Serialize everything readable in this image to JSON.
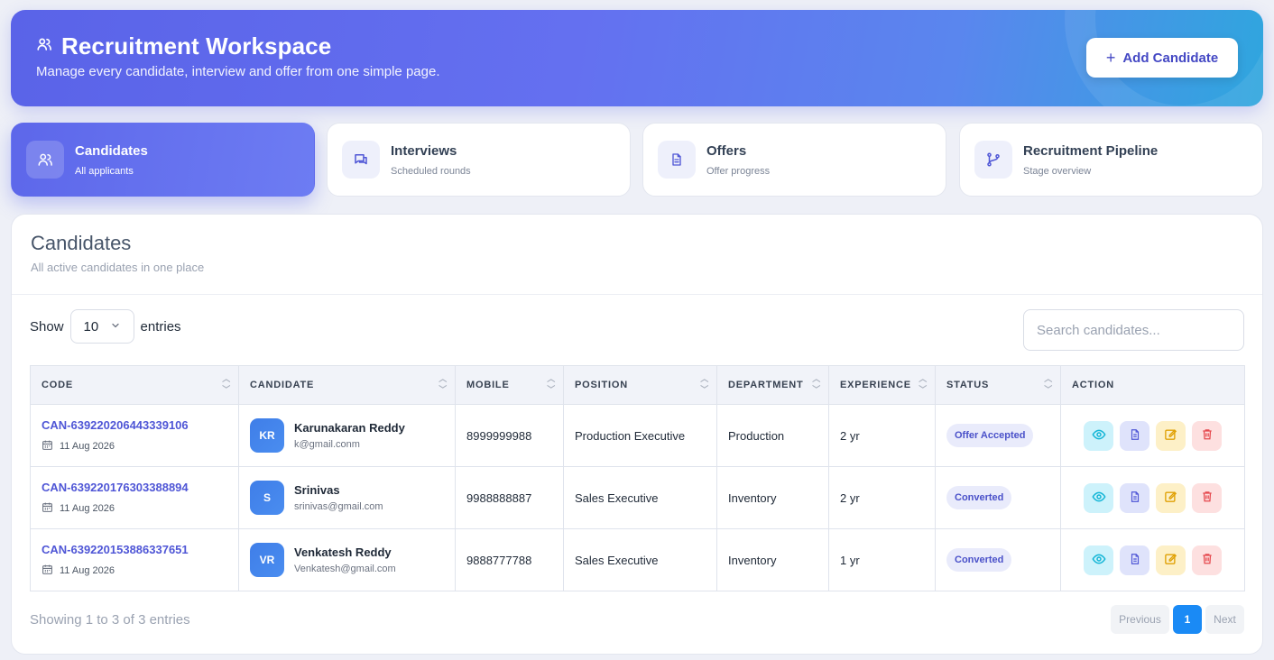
{
  "header": {
    "title": "Recruitment Workspace",
    "subtitle": "Manage every candidate, interview and offer from one simple page.",
    "add_button_label": "Add Candidate",
    "title_icon": "users-icon",
    "add_icon": "plus-icon"
  },
  "tabs": [
    {
      "label": "Candidates",
      "sub": "All applicants",
      "icon": "users-icon",
      "active": true
    },
    {
      "label": "Interviews",
      "sub": "Scheduled rounds",
      "icon": "chat-icon",
      "active": false
    },
    {
      "label": "Offers",
      "sub": "Offer progress",
      "icon": "document-icon",
      "active": false
    },
    {
      "label": "Recruitment Pipeline",
      "sub": "Stage overview",
      "icon": "branch-icon",
      "active": false
    }
  ],
  "card": {
    "title": "Candidates",
    "subtitle": "All active candidates in one place"
  },
  "controls": {
    "show_label": "Show",
    "entries_value": "10",
    "entries_label": "entries",
    "search_placeholder": "Search candidates..."
  },
  "table": {
    "columns": [
      "CODE",
      "CANDIDATE",
      "MOBILE",
      "POSITION",
      "DEPARTMENT",
      "EXPERIENCE",
      "STATUS",
      "ACTION"
    ],
    "rows": [
      {
        "code": "CAN-639220206443339106",
        "date": "11 Aug 2026",
        "initials": "KR",
        "name": "Karunakaran Reddy",
        "email": "k@gmail.conm",
        "mobile": "8999999988",
        "position": "Production Executive",
        "department": "Production",
        "experience": "2 yr",
        "status": "Offer Accepted"
      },
      {
        "code": "CAN-639220176303388894",
        "date": "11 Aug 2026",
        "initials": "S",
        "name": "Srinivas",
        "email": "srinivas@gmail.com",
        "mobile": "9988888887",
        "position": "Sales Executive",
        "department": "Inventory",
        "experience": "2 yr",
        "status": "Converted"
      },
      {
        "code": "CAN-639220153886337651",
        "date": "11 Aug 2026",
        "initials": "VR",
        "name": "Venkatesh Reddy",
        "email": "Venkatesh@gmail.com",
        "mobile": "9888777788",
        "position": "Sales Executive",
        "department": "Inventory",
        "experience": "1 yr",
        "status": "Converted"
      }
    ]
  },
  "footer": {
    "showing": "Showing 1 to 3 of 3 entries",
    "previous": "Previous",
    "page": "1",
    "next": "Next"
  },
  "colors": {
    "accent": "#5a63e8",
    "link": "#4f56d6",
    "page_active": "#1a8af5",
    "view": "#12b5d6",
    "doc": "#4f56d6",
    "edit": "#e0a106",
    "delete": "#e5484d"
  }
}
